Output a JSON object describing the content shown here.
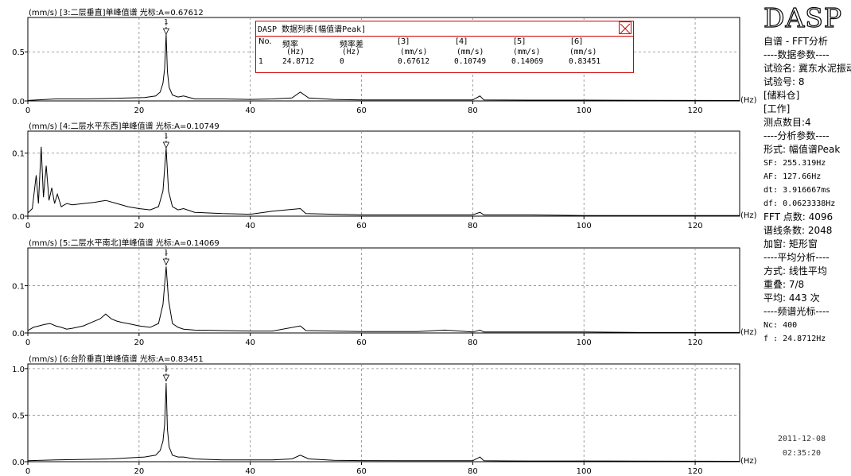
{
  "popup": {
    "title": "DASP 数据列表[幅值谱Peak]",
    "columns": [
      {
        "name": "No.",
        "unit": ""
      },
      {
        "name": "频率",
        "unit": "(Hz)"
      },
      {
        "name": "频率差",
        "unit": "(Hz)"
      },
      {
        "name": "[3]",
        "unit": "(mm/s)"
      },
      {
        "name": "[4]",
        "unit": "(mm/s)"
      },
      {
        "name": "[5]",
        "unit": "(mm/s)"
      },
      {
        "name": "[6]",
        "unit": "(mm/s)"
      }
    ],
    "row": [
      "1",
      "24.8712",
      "0",
      "0.67612",
      "0.10749",
      "0.14069",
      "0.83451"
    ]
  },
  "sidebar": {
    "logo": "DASP",
    "lines": [
      "自谱 - FFT分析",
      "----数据参数----",
      "试验名: 冀东水泥振动",
      "试验号: 8",
      "[储料仓]",
      "[工作]",
      "测点数目:4",
      "----分析参数----",
      "形式: 幅值谱Peak",
      "SF: 255.319Hz",
      "AF: 127.66Hz",
      "dt: 3.916667ms",
      "df: 0.0623338Hz",
      "FFT 点数: 4096",
      "谱线条数: 2048",
      "加窗: 矩形窗",
      "----平均分析----",
      "方式: 线性平均",
      "重叠: 7/8",
      "平均: 443 次",
      "----频谱光标----",
      "Nc: 400",
      "f : 24.8712Hz"
    ],
    "date": "2011-12-08",
    "time": "02:35:20"
  },
  "chart_data": [
    {
      "type": "line",
      "title": "(mm/s) [3:二层垂直]单峰值谱 光标:A=0.67612",
      "xlabel": "(Hz)",
      "ylabel": "(mm/s)",
      "xlim": [
        0,
        128
      ],
      "ylim": [
        0,
        0.85
      ],
      "xticks": [
        0,
        20,
        40,
        60,
        80,
        100,
        120
      ],
      "yticks": [
        0,
        0.5
      ],
      "ytick_labels": [
        "0.0",
        "0.5"
      ],
      "grid": true,
      "cursor": {
        "label": "1",
        "x": 24.8712,
        "y": 0.67612
      },
      "x": [
        0,
        5,
        10,
        15,
        18,
        21,
        23,
        23.8,
        24.3,
        24.6,
        24.8712,
        25.1,
        25.4,
        26,
        27,
        28,
        30,
        35,
        40,
        44,
        47.5,
        49,
        50.5,
        55,
        60,
        70,
        80,
        81.3,
        82,
        90,
        100,
        110,
        120,
        128
      ],
      "values": [
        0.005,
        0.02,
        0.02,
        0.025,
        0.03,
        0.035,
        0.05,
        0.09,
        0.18,
        0.33,
        0.67612,
        0.3,
        0.14,
        0.06,
        0.04,
        0.05,
        0.02,
        0.02,
        0.015,
        0.02,
        0.03,
        0.09,
        0.03,
        0.015,
        0.01,
        0.01,
        0.01,
        0.05,
        0.01,
        0.008,
        0.008,
        0.006,
        0.005,
        0.004
      ]
    },
    {
      "type": "line",
      "title": "(mm/s) [4:二层水平东西]单峰值谱 光标:A=0.10749",
      "xlabel": "(Hz)",
      "ylabel": "(mm/s)",
      "xlim": [
        0,
        128
      ],
      "ylim": [
        0,
        0.135
      ],
      "xticks": [
        0,
        20,
        40,
        60,
        80,
        100,
        120
      ],
      "yticks": [
        0,
        0.1
      ],
      "ytick_labels": [
        "0.0",
        "0.1"
      ],
      "grid": true,
      "cursor": {
        "label": "1",
        "x": 24.8712,
        "y": 0.10749
      },
      "x": [
        0,
        0.8,
        1.5,
        1.9,
        2.4,
        2.8,
        3.3,
        3.8,
        4.3,
        4.8,
        5.3,
        6,
        7,
        8,
        10,
        12,
        14,
        16,
        18,
        20,
        22,
        23.5,
        24.3,
        24.8712,
        25.3,
        26,
        27,
        28,
        30,
        35,
        40,
        44,
        49,
        50,
        55,
        60,
        70,
        80,
        81.3,
        82,
        90,
        100,
        110,
        120,
        128
      ],
      "values": [
        0.005,
        0.012,
        0.065,
        0.02,
        0.11,
        0.03,
        0.08,
        0.025,
        0.045,
        0.02,
        0.035,
        0.015,
        0.02,
        0.018,
        0.02,
        0.022,
        0.025,
        0.02,
        0.015,
        0.012,
        0.01,
        0.015,
        0.04,
        0.10749,
        0.04,
        0.015,
        0.01,
        0.012,
        0.006,
        0.004,
        0.003,
        0.008,
        0.012,
        0.004,
        0.003,
        0.002,
        0.002,
        0.002,
        0.006,
        0.002,
        0.002,
        0.001,
        0.001,
        0.001,
        0.001
      ]
    },
    {
      "type": "line",
      "title": "(mm/s) [5:二层水平南北]单峰值谱 光标:A=0.14069",
      "xlabel": "(Hz)",
      "ylabel": "(mm/s)",
      "xlim": [
        0,
        128
      ],
      "ylim": [
        0,
        0.18
      ],
      "xticks": [
        0,
        20,
        40,
        60,
        80,
        100,
        120
      ],
      "yticks": [
        0,
        0.1
      ],
      "ytick_labels": [
        "0.0",
        "0.1"
      ],
      "grid": true,
      "cursor": {
        "label": "1",
        "x": 24.8712,
        "y": 0.14069
      },
      "x": [
        0,
        1,
        2,
        3,
        4,
        5,
        6,
        7,
        8,
        10,
        12,
        13,
        14,
        15,
        16,
        17,
        18,
        20,
        22,
        23.5,
        24.3,
        24.8712,
        25.3,
        26,
        27,
        28,
        30,
        35,
        40,
        44,
        49,
        50,
        55,
        60,
        70,
        75,
        80,
        81.3,
        82,
        90,
        100,
        110,
        120,
        128
      ],
      "values": [
        0.005,
        0.012,
        0.015,
        0.018,
        0.02,
        0.015,
        0.012,
        0.008,
        0.01,
        0.015,
        0.025,
        0.03,
        0.04,
        0.03,
        0.025,
        0.022,
        0.02,
        0.015,
        0.012,
        0.02,
        0.06,
        0.14069,
        0.07,
        0.02,
        0.012,
        0.008,
        0.006,
        0.005,
        0.004,
        0.004,
        0.015,
        0.005,
        0.004,
        0.003,
        0.003,
        0.006,
        0.002,
        0.006,
        0.002,
        0.002,
        0.002,
        0.001,
        0.001,
        0.001
      ]
    },
    {
      "type": "line",
      "title": "(mm/s) [6:台阶垂直]单峰值谱 光标:A=0.83451",
      "xlabel": "(Hz)",
      "ylabel": "(mm/s)",
      "xlim": [
        0,
        128
      ],
      "ylim": [
        0,
        1.05
      ],
      "xticks": [
        0,
        20,
        40,
        60,
        80,
        100,
        120
      ],
      "yticks": [
        0,
        0.5,
        1.0
      ],
      "ytick_labels": [
        "0.0",
        "0.5",
        "1.0"
      ],
      "grid": true,
      "cursor": {
        "label": "1",
        "x": 24.8712,
        "y": 0.83451
      },
      "x": [
        0,
        5,
        10,
        15,
        18,
        21,
        23,
        23.8,
        24.3,
        24.6,
        24.8712,
        25.1,
        25.4,
        26,
        27,
        28,
        30,
        35,
        40,
        44,
        47.5,
        49,
        50.5,
        55,
        60,
        70,
        80,
        81.3,
        82,
        90,
        100,
        110,
        120,
        128
      ],
      "values": [
        0.01,
        0.02,
        0.025,
        0.03,
        0.04,
        0.05,
        0.07,
        0.12,
        0.22,
        0.4,
        0.83451,
        0.35,
        0.16,
        0.07,
        0.05,
        0.05,
        0.03,
        0.02,
        0.02,
        0.02,
        0.03,
        0.07,
        0.03,
        0.015,
        0.012,
        0.01,
        0.01,
        0.05,
        0.01,
        0.008,
        0.008,
        0.006,
        0.005,
        0.004
      ]
    }
  ]
}
